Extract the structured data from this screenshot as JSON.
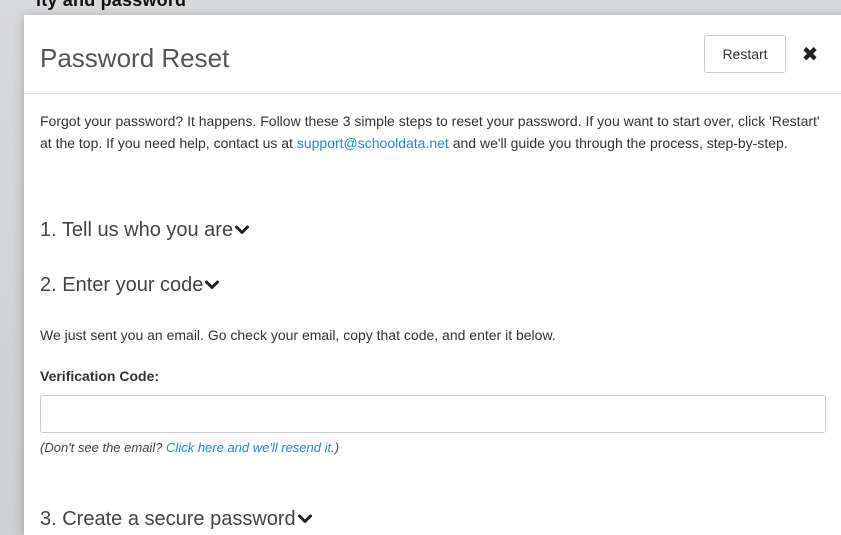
{
  "backdrop": {
    "title_fragment": "ity and password"
  },
  "modal": {
    "title": "Password Reset",
    "restart_label": "Restart",
    "close_glyph": "✖",
    "intro": {
      "text_before": "Forgot your password? It happens. Follow these 3 simple steps to reset your password. If you want to start over, click 'Restart' at the top. If you need help, contact us at ",
      "support_email": "support@schooldata.net",
      "text_after": " and we'll guide you through the process, step-by-step."
    },
    "steps": [
      {
        "label": "1. Tell us who you are",
        "icon": "chevron-down-icon"
      },
      {
        "label": "2. Enter your code",
        "icon": "chevron-down-icon"
      },
      {
        "label": "3. Create a secure password",
        "icon": "chevron-down-icon"
      }
    ],
    "code_step": {
      "instructions": "We just sent you an email. Go check your email, copy that code, and enter it below.",
      "field_label": "Verification Code:",
      "field_value": "",
      "resend_prefix": "(Don't see the email? ",
      "resend_link": "Click here and we'll resend it.",
      "resend_suffix": ")"
    }
  }
}
